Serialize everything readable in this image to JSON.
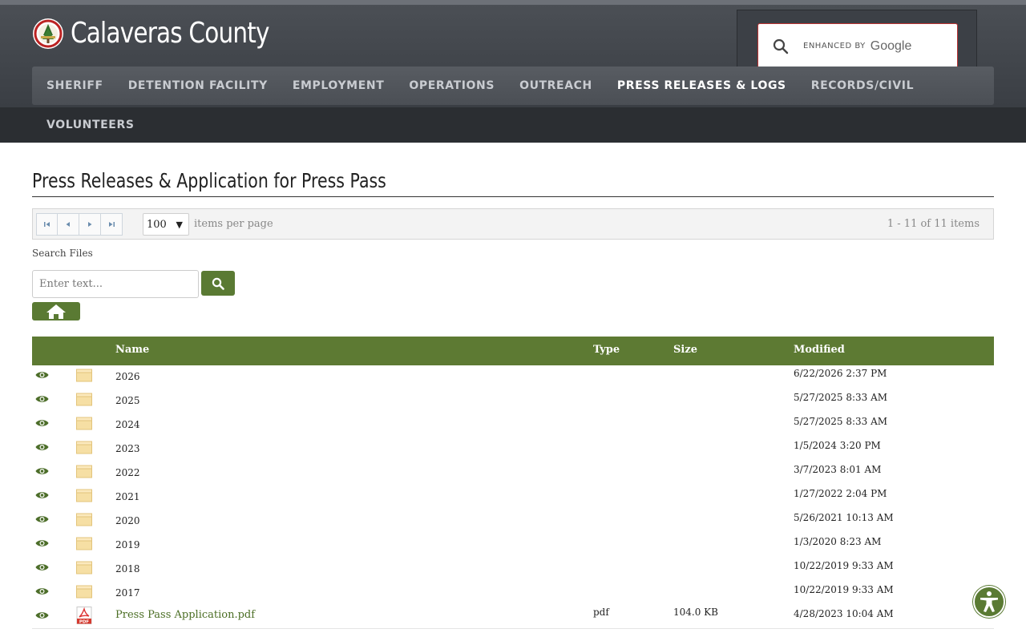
{
  "header": {
    "site_name": "Calaveras County",
    "search": {
      "enhanced_by": "enhanced by",
      "provider": "Google"
    }
  },
  "nav": {
    "items": [
      {
        "label": "SHERIFF"
      },
      {
        "label": "DETENTION FACILITY"
      },
      {
        "label": "EMPLOYMENT"
      },
      {
        "label": "OPERATIONS"
      },
      {
        "label": "OUTREACH"
      },
      {
        "label": "PRESS RELEASES & LOGS",
        "active": true
      },
      {
        "label": "RECORDS/CIVIL"
      },
      {
        "label": "VOLUNTEERS"
      }
    ]
  },
  "page": {
    "title": "Press Releases & Application for Press Pass"
  },
  "pager": {
    "per_page": "100",
    "per_page_label": "items per page",
    "info": "1 - 11 of 11 items"
  },
  "search_files": {
    "label": "Search Files",
    "placeholder": "Enter text..."
  },
  "table": {
    "headers": {
      "name": "Name",
      "type": "Type",
      "size": "Size",
      "modified": "Modified"
    },
    "rows": [
      {
        "kind": "folder",
        "name": "2026",
        "type": "",
        "size": "",
        "modified": "6/22/2026 2:37 PM"
      },
      {
        "kind": "folder",
        "name": "2025",
        "type": "",
        "size": "",
        "modified": "5/27/2025 8:33 AM"
      },
      {
        "kind": "folder",
        "name": "2024",
        "type": "",
        "size": "",
        "modified": "5/27/2025 8:33 AM"
      },
      {
        "kind": "folder",
        "name": "2023",
        "type": "",
        "size": "",
        "modified": "1/5/2024 3:20 PM"
      },
      {
        "kind": "folder",
        "name": "2022",
        "type": "",
        "size": "",
        "modified": "3/7/2023 8:01 AM"
      },
      {
        "kind": "folder",
        "name": "2021",
        "type": "",
        "size": "",
        "modified": "1/27/2022 2:04 PM"
      },
      {
        "kind": "folder",
        "name": "2020",
        "type": "",
        "size": "",
        "modified": "5/26/2021 10:13 AM"
      },
      {
        "kind": "folder",
        "name": "2019",
        "type": "",
        "size": "",
        "modified": "1/3/2020 8:23 AM"
      },
      {
        "kind": "folder",
        "name": "2018",
        "type": "",
        "size": "",
        "modified": "10/22/2019 9:33 AM"
      },
      {
        "kind": "folder",
        "name": "2017",
        "type": "",
        "size": "",
        "modified": "10/22/2019 9:33 AM"
      },
      {
        "kind": "pdf",
        "name": "Press Pass Application.pdf",
        "type": "pdf",
        "size": "104.0 KB",
        "modified": "4/28/2023 10:04 AM"
      }
    ]
  },
  "colors": {
    "accent_green": "#5d7a33",
    "header_dark": "#3a3e44",
    "link_green": "#4b6e24"
  },
  "icons": {
    "pager": [
      "first-page-icon",
      "prev-page-icon",
      "next-page-icon",
      "last-page-icon"
    ],
    "search": "search-icon",
    "home": "home-icon",
    "view": "eye-icon",
    "folder": "folder-icon",
    "pdf": "pdf-file-icon",
    "accessibility": "accessibility-icon"
  }
}
